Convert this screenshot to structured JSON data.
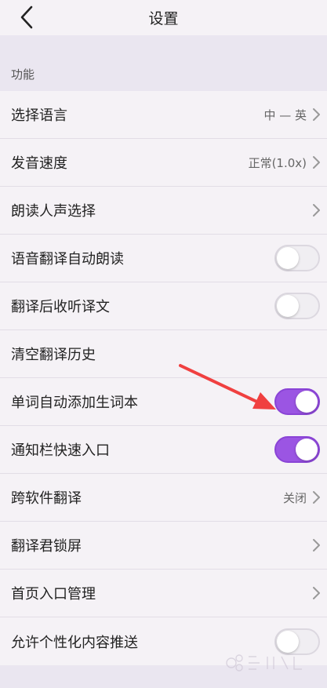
{
  "header": {
    "title": "设置",
    "back_icon": "chevron-left-icon"
  },
  "section": {
    "label": "功能"
  },
  "rows": [
    {
      "label": "选择语言",
      "value": "中 — 英",
      "control": "chevron"
    },
    {
      "label": "发音速度",
      "value": "正常(1.0x)",
      "control": "chevron"
    },
    {
      "label": "朗读人声选择",
      "value": "",
      "control": "chevron"
    },
    {
      "label": "语音翻译自动朗读",
      "control": "toggle",
      "on": false
    },
    {
      "label": "翻译后收听译文",
      "control": "toggle",
      "on": false
    },
    {
      "label": "清空翻译历史",
      "control": "none"
    },
    {
      "label": "单词自动添加生词本",
      "control": "toggle",
      "on": true
    },
    {
      "label": "通知栏快速入口",
      "control": "toggle",
      "on": true
    },
    {
      "label": "跨软件翻译",
      "value": "关闭",
      "control": "chevron"
    },
    {
      "label": "翻译君锁屏",
      "value": "",
      "control": "chevron"
    },
    {
      "label": "首页入口管理",
      "value": "",
      "control": "chevron"
    },
    {
      "label": "允许个性化内容推送",
      "control": "toggle",
      "on": false
    }
  ],
  "colors": {
    "accent": "#9b55e3",
    "background": "#eae6f0",
    "annotation_arrow": "#f04040"
  },
  "watermark": {
    "logo": "baidu-jingyan-watermark"
  }
}
